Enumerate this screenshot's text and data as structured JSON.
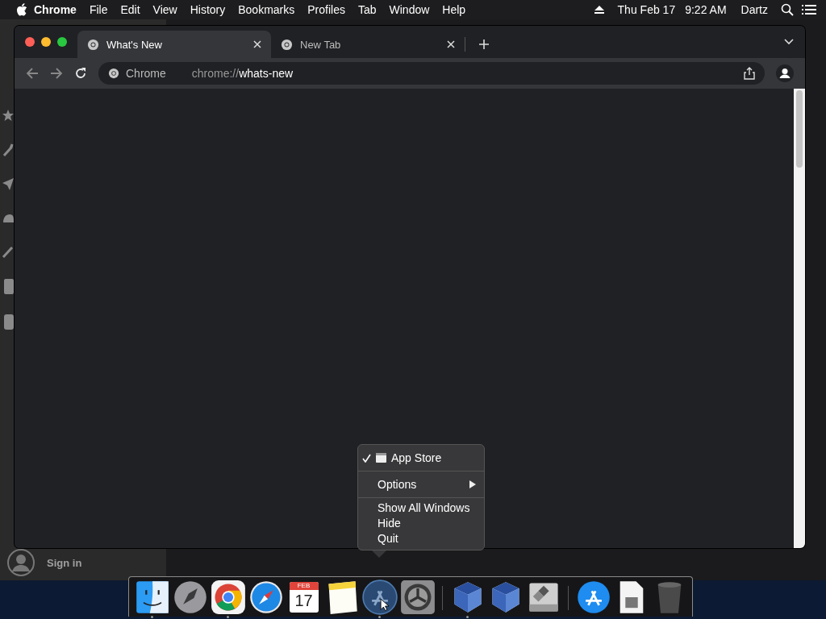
{
  "menu_bar": {
    "app_name": "Chrome",
    "menus": [
      "File",
      "Edit",
      "View",
      "History",
      "Bookmarks",
      "Profiles",
      "Tab",
      "Window",
      "Help"
    ],
    "date": "Thu Feb 17",
    "time": "9:22 AM",
    "user": "Dartz"
  },
  "background_window": {
    "sign_in": "Sign in"
  },
  "browser": {
    "tabs": [
      {
        "title": "What's New",
        "selected": true
      },
      {
        "title": "New Tab",
        "selected": false
      }
    ],
    "address": {
      "origin": "Chrome",
      "url": "chrome://**whats-new**"
    }
  },
  "context_menu": {
    "items": [
      {
        "kind": "window",
        "label": "App Store",
        "checked": true
      },
      {
        "kind": "separator"
      },
      {
        "kind": "submenu",
        "label": "Options"
      },
      {
        "kind": "separator"
      },
      {
        "kind": "action",
        "label": "Show All Windows"
      },
      {
        "kind": "action",
        "label": "Hide"
      },
      {
        "kind": "action",
        "label": "Quit"
      }
    ]
  },
  "dock": {
    "items": [
      {
        "kind": "finder",
        "running": true
      },
      {
        "kind": "launchpad",
        "running": false
      },
      {
        "kind": "chrome",
        "running": true
      },
      {
        "kind": "safari",
        "running": false
      },
      {
        "kind": "calendar",
        "running": false,
        "month": "FEB",
        "day": "17"
      },
      {
        "kind": "notes",
        "running": false
      },
      {
        "kind": "appstore",
        "running": true,
        "selected": true
      },
      {
        "kind": "settings",
        "running": false
      },
      {
        "kind": "separator"
      },
      {
        "kind": "virtualbox",
        "running": true
      },
      {
        "kind": "virtualbox",
        "running": false
      },
      {
        "kind": "bootcamp",
        "running": false
      },
      {
        "kind": "separator"
      },
      {
        "kind": "appstore-folder",
        "running": false
      },
      {
        "kind": "disk-file",
        "running": false
      },
      {
        "kind": "trash",
        "running": false
      }
    ]
  }
}
